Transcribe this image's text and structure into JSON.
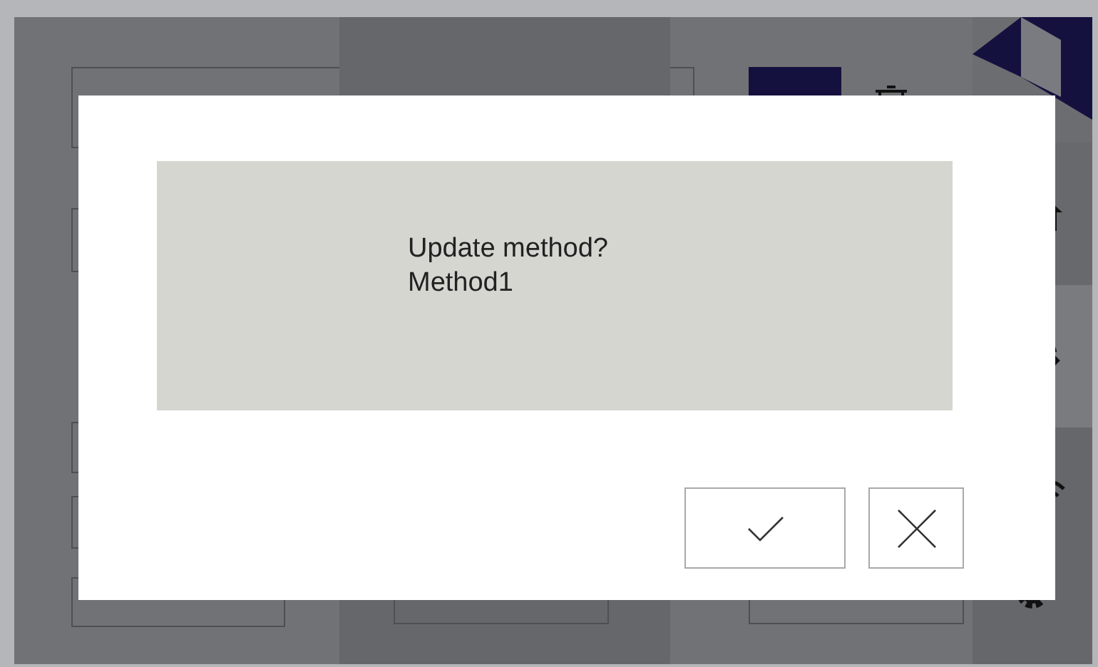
{
  "dialog": {
    "title": "Update method?",
    "method_name": "Method1",
    "buttons": [
      {
        "kind": "confirm"
      },
      {
        "kind": "cancel"
      }
    ]
  }
}
